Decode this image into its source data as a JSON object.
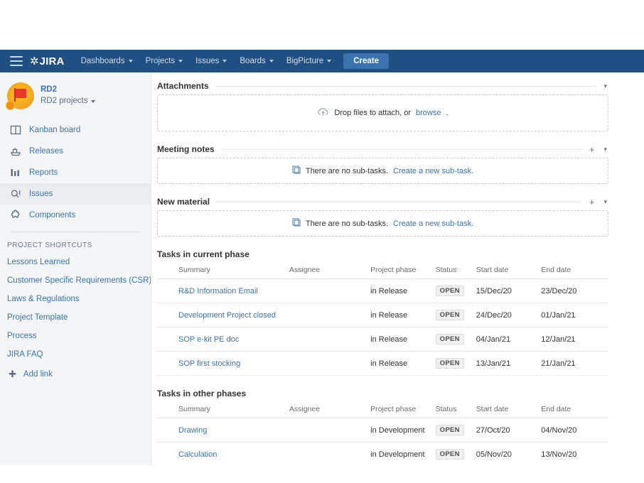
{
  "navbar": {
    "menu_icon": "hamburger-icon",
    "brand": "JIRA",
    "items": [
      {
        "label": "Dashboards",
        "has_caret": true
      },
      {
        "label": "Projects",
        "has_caret": true
      },
      {
        "label": "Issues",
        "has_caret": true
      },
      {
        "label": "Boards",
        "has_caret": true
      },
      {
        "label": "BigPicture",
        "has_caret": true
      }
    ],
    "create_label": "Create"
  },
  "sidebar": {
    "project_name": "RD2",
    "project_type": "RD2 projects",
    "items": [
      {
        "label": "Kanban board",
        "icon": "board-icon",
        "active": false
      },
      {
        "label": "Releases",
        "icon": "releases-icon",
        "active": false
      },
      {
        "label": "Reports",
        "icon": "reports-icon",
        "active": false
      },
      {
        "label": "Issues",
        "icon": "search-icon",
        "active": true
      },
      {
        "label": "Components",
        "icon": "components-icon",
        "active": false
      }
    ],
    "shortcuts_title": "PROJECT SHORTCUTS",
    "shortcuts": [
      "Lessons Learned",
      "Customer Specific Requirements (CSR)",
      "Laws & Regulations",
      "Project Template",
      "Process",
      "JIRA FAQ"
    ],
    "add_link_label": "Add link"
  },
  "main": {
    "attachments": {
      "title": "Attachments",
      "drop_text": "Drop files to attach, or ",
      "browse_label": "browse",
      "drop_suffix": ".",
      "caret_label": "▾"
    },
    "meeting_notes": {
      "title": "Meeting notes",
      "empty_text": "There are no sub-tasks.",
      "create_label": "Create a new sub-task.",
      "plus_label": "+",
      "caret_label": "▾"
    },
    "new_material": {
      "title": "New material",
      "empty_text": "There are no sub-tasks.",
      "create_label": "Create a new sub-task.",
      "plus_label": "+",
      "caret_label": "▾"
    },
    "table_current": {
      "title": "Tasks in current phase",
      "columns": [
        "Summary",
        "Assignee",
        "Project phase",
        "Status",
        "Start date",
        "End date"
      ],
      "rows": [
        {
          "summary": "R&D Information Email",
          "assignee": "",
          "phase": "in Release",
          "status": "OPEN",
          "start": "15/Dec/20",
          "end": "23/Dec/20"
        },
        {
          "summary": "Development Project closed",
          "assignee": "",
          "phase": "in Release",
          "status": "OPEN",
          "start": "24/Dec/20",
          "end": "01/Jan/21"
        },
        {
          "summary": "SOP e-kit PE doc",
          "assignee": "",
          "phase": "in Release",
          "status": "OPEN",
          "start": "04/Jan/21",
          "end": "12/Jan/21"
        },
        {
          "summary": "SOP first stocking",
          "assignee": "",
          "phase": "in Release",
          "status": "OPEN",
          "start": "13/Jan/21",
          "end": "21/Jan/21"
        }
      ]
    },
    "table_other": {
      "title": "Tasks in other phases",
      "columns": [
        "Summary",
        "Assignee",
        "Project phase",
        "Status",
        "Start date",
        "End date"
      ],
      "rows": [
        {
          "summary": "Drawing",
          "assignee": "",
          "phase": "in Development",
          "status": "OPEN",
          "start": "27/Oct/20",
          "end": "04/Nov/20"
        },
        {
          "summary": "Calculation",
          "assignee": "",
          "phase": "in Development",
          "status": "OPEN",
          "start": "05/Nov/20",
          "end": "13/Nov/20"
        }
      ]
    }
  },
  "colors": {
    "navbar": "#205081",
    "create_button": "#3b73af",
    "link": "#3b73af",
    "sidebar_bg": "#f4f5f7",
    "avatar": "#f5a623"
  }
}
